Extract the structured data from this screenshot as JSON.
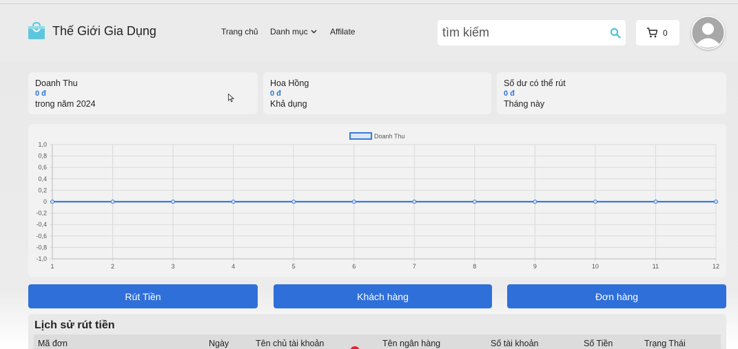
{
  "header": {
    "brand_name": "Thế Giới Gia Dụng",
    "brand_color": "#4fc3d9",
    "nav": {
      "home": "Trang chủ",
      "category": "Danh mục",
      "affiliate": "Affilate"
    },
    "search_placeholder": "tìm kiếm",
    "cart_count": "0"
  },
  "stats": [
    {
      "label": "Doanh Thu",
      "value": "0 đ",
      "sub": "trong năm 2024"
    },
    {
      "label": "Hoa Hồng",
      "value": "0 đ",
      "sub": "Khả dụng"
    },
    {
      "label": "Số dư có thể rút",
      "value": "0 đ",
      "sub": "Tháng này"
    }
  ],
  "chart_data": {
    "type": "line",
    "x": [
      1,
      2,
      3,
      4,
      5,
      6,
      7,
      8,
      9,
      10,
      11,
      12
    ],
    "series": [
      {
        "name": "Doanh Thu",
        "values": [
          0,
          0,
          0,
          0,
          0,
          0,
          0,
          0,
          0,
          0,
          0,
          0
        ],
        "color": "#3a78d8"
      }
    ],
    "y_ticks": [
      "1,0",
      "0,8",
      "0,6",
      "0,4",
      "0,2",
      "0",
      "-0,2",
      "-0,4",
      "-0,6",
      "-0,8",
      "-1,0"
    ],
    "x_ticks": [
      "1",
      "2",
      "3",
      "4",
      "5",
      "6",
      "7",
      "8",
      "9",
      "10",
      "11",
      "12"
    ],
    "ylim": [
      -1,
      1
    ],
    "xlim": [
      1,
      12
    ],
    "grid": true,
    "legend_position": "top-center"
  },
  "actions": {
    "withdraw": "Rút Tiền",
    "customers": "Khách hàng",
    "orders": "Đơn hàng",
    "button_color": "#2f6fd9"
  },
  "history": {
    "title": "Lịch sử rút tiền",
    "columns": [
      "Mã đơn",
      "Ngày",
      "Tên chủ tài khoản",
      "Tên ngân hàng",
      "Số tài khoản",
      "Số Tiền",
      "Trạng Thái"
    ]
  }
}
